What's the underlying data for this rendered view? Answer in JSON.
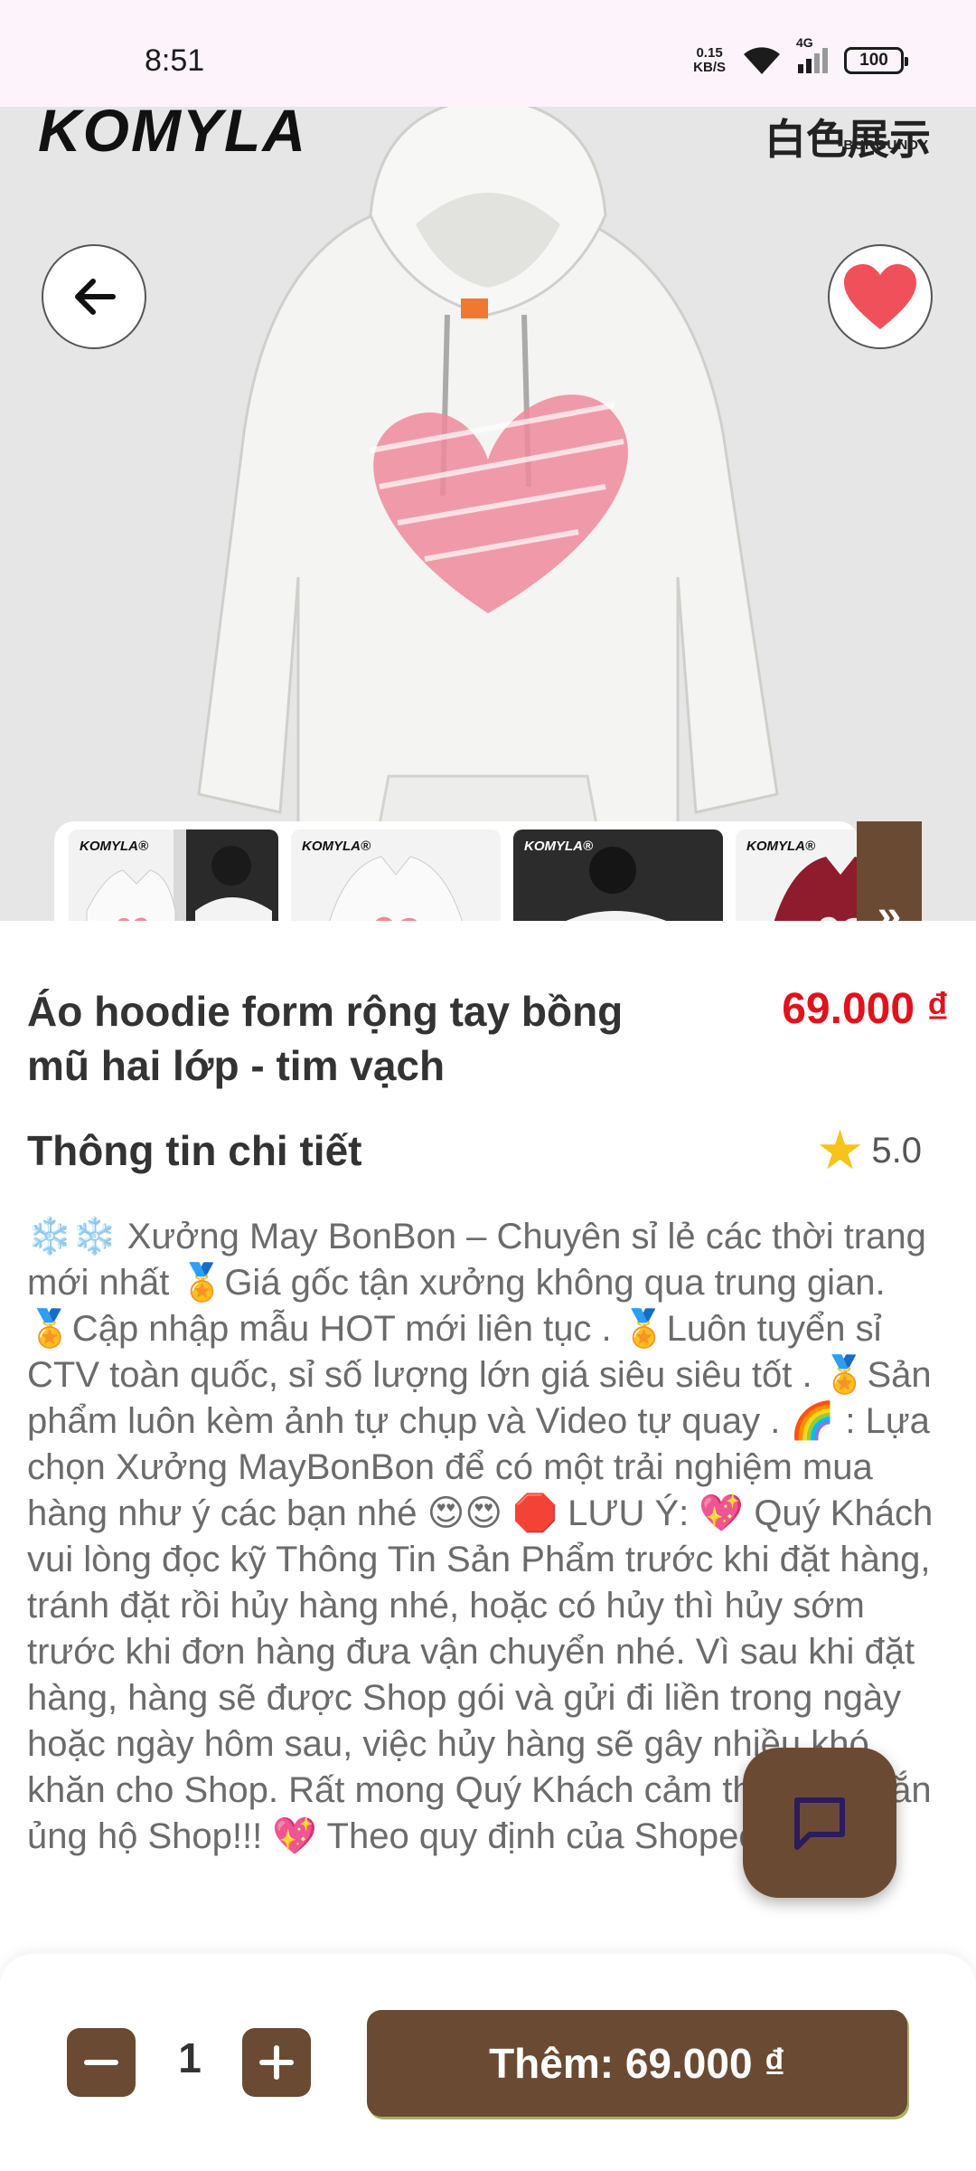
{
  "status_bar": {
    "time": "8:51",
    "net_speed_value": "0.15",
    "net_speed_unit": "KB/S",
    "network": "4G",
    "battery": "100"
  },
  "hero": {
    "brand": "KOMYLA",
    "brand_right": "白色展示",
    "brand_right_sub": "BURGUNDY",
    "back_icon": "arrow-left-icon",
    "favorite_icon": "heart-icon",
    "favorite_color": "#f0505a"
  },
  "thumbnails": [
    {
      "label": "KOMYLA®"
    },
    {
      "label": "KOMYLA®"
    },
    {
      "label": "KOMYLA®"
    },
    {
      "label": "KOMYLA®"
    }
  ],
  "product": {
    "title": "Áo hoodie form rộng tay bồng mũ hai lớp - tim vạch",
    "price": "69.000 ₫",
    "section_title": "Thông tin chi tiết",
    "rating": "5.0",
    "description": "❄️❄️ Xưởng May BonBon – Chuyên sỉ lẻ các thời trang mới nhất 🏅Giá gốc tận xưởng không qua trung gian. 🏅Cập nhập mẫu HOT mới liên tục . 🏅Luôn tuyển sỉ CTV toàn quốc, sỉ số lượng lớn giá siêu siêu tốt . 🏅Sản phẩm luôn kèm ảnh tự chụp và Video tự quay . 🌈 : Lựa chọn Xưởng MayBonBon để có một trải nghiệm mua hàng như ý các bạn nhé 😍😍 🛑 LƯU Ý: 💖 Quý Khách vui lòng đọc kỹ Thông Tin Sản Phẩm trước khi đặt hàng, tránh đặt rồi hủy hàng nhé, hoặc có hủy thì hủy sớm trước khi đơn hàng đưa vận chuyển nhé. Vì sau khi đặt hàng, hàng sẽ được Shop gói và gửi đi liền trong ngày hoặc ngày hôm sau, việc hủy hàng sẽ gây nhiều khó khăn cho Shop. Rất mong Quý Khách cảm thông và đắn ủng hộ Shop!!! 💖 Theo quy định của Shopee Khách"
  },
  "cart": {
    "quantity": "1",
    "add_label": "Thêm: 69.000 ₫"
  },
  "colors": {
    "accent": "#6b4a33",
    "price": "#e0121b",
    "star": "#f6c21c"
  }
}
